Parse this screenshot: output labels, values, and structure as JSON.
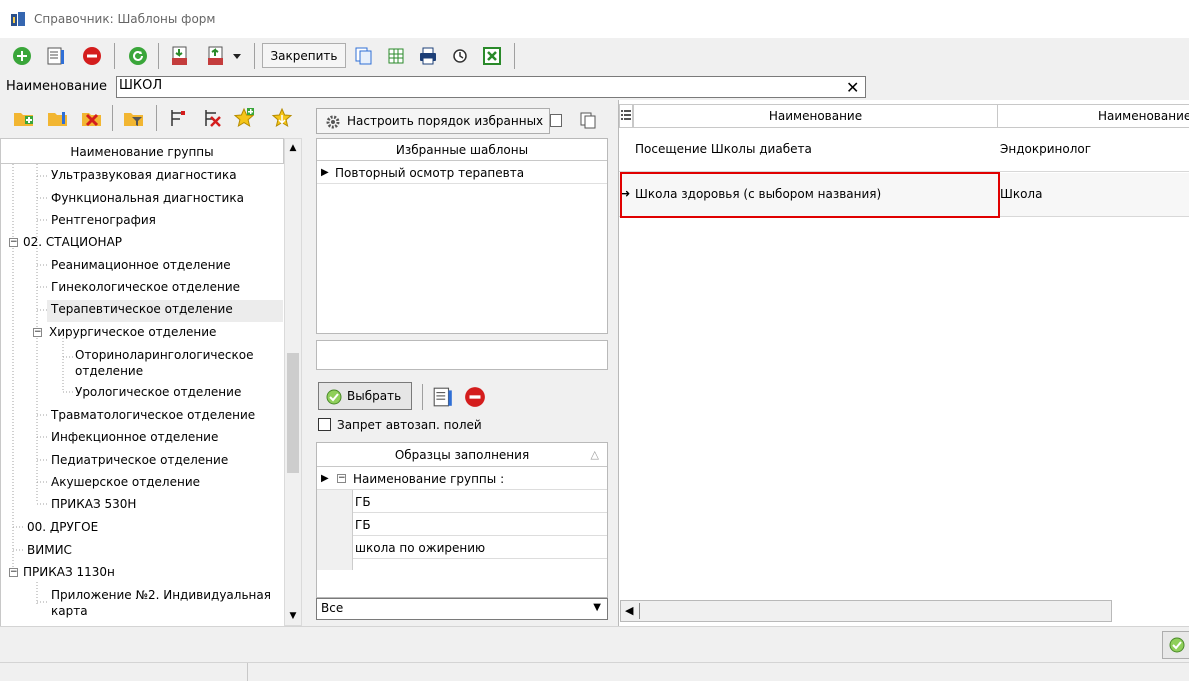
{
  "window": {
    "title": "Справочник: Шаблоны форм"
  },
  "toolbar": {
    "pin_label": "Закрепить"
  },
  "search": {
    "label": "Наименование",
    "value": "ШКОЛ",
    "clear_icon": "close-icon"
  },
  "groups": {
    "header": "Наименование группы",
    "items": [
      "Ультразвуковая диагностика",
      "Функциональная диагностика",
      "Рентгенография",
      "02. СТАЦИОНАР",
      "Реанимационное отделение",
      "Гинекологическое отделение",
      "Терапевтическое отделение",
      "Хирургическое отделение",
      "Оториноларингологическое",
      "отделение",
      "Урологическое отделение",
      "Травматологическое отделение",
      "Инфекционное отделение",
      "Педиатрическое отделение",
      "Акушерское отделение",
      "ПРИКАЗ 530Н",
      "00. ДРУГОЕ",
      "ВИМИС",
      "ПРИКАЗ 1130н",
      "Приложение №2. Индивидуальная",
      "карта"
    ]
  },
  "favorites": {
    "configure_label": "Настроить порядок избранных",
    "header": "Избранные шаблоны",
    "items": [
      "Повторный осмотр терапевта"
    ]
  },
  "actions": {
    "choose_label": "Выбрать",
    "autofill_lock_label": "Запрет автозап. полей"
  },
  "samples": {
    "header": "Образцы заполнения",
    "group_label": "Наименование группы :",
    "rows": [
      "ГБ",
      "ГБ",
      "школа по ожирению"
    ]
  },
  "filter": {
    "value": "Все"
  },
  "templates": {
    "columns": [
      "Наименование",
      "Наименование"
    ],
    "rows": [
      {
        "name": "Посещение Школы диабета",
        "specialty": "Эндокринолог"
      },
      {
        "name": "Школа здоровья (с выбором названия)",
        "specialty": "Школа"
      }
    ]
  },
  "colors": {
    "highlight": "#e00000",
    "accent_green": "#3aa63a",
    "danger_red": "#d41d1d"
  }
}
